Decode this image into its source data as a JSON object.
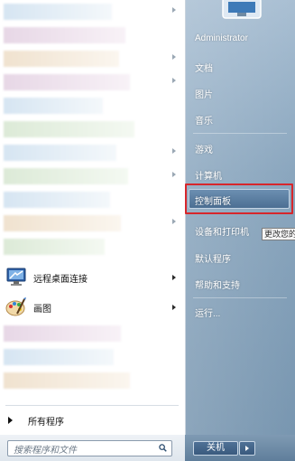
{
  "programs": {
    "remote_desktop": {
      "label": "远程桌面连接",
      "icon": "remote-desktop-icon"
    },
    "paint": {
      "label": "画图",
      "icon": "paint-palette-icon"
    },
    "all_programs": "所有程序"
  },
  "search": {
    "placeholder": "搜索程序和文件",
    "icon": "search-icon"
  },
  "right_menu": {
    "user": "Administrator",
    "documents": "文档",
    "pictures": "图片",
    "music": "音乐",
    "games": "游戏",
    "computer": "计算机",
    "control_panel": "控制面板",
    "devices_printers": "设备和打印机",
    "default_programs": "默认程序",
    "help_support": "帮助和支持",
    "run": "运行..."
  },
  "tooltip": "更改您的",
  "shutdown": {
    "label": "关机"
  },
  "colors": {
    "highlight_border": "#d7262b",
    "right_pane": "#8aa6be"
  }
}
